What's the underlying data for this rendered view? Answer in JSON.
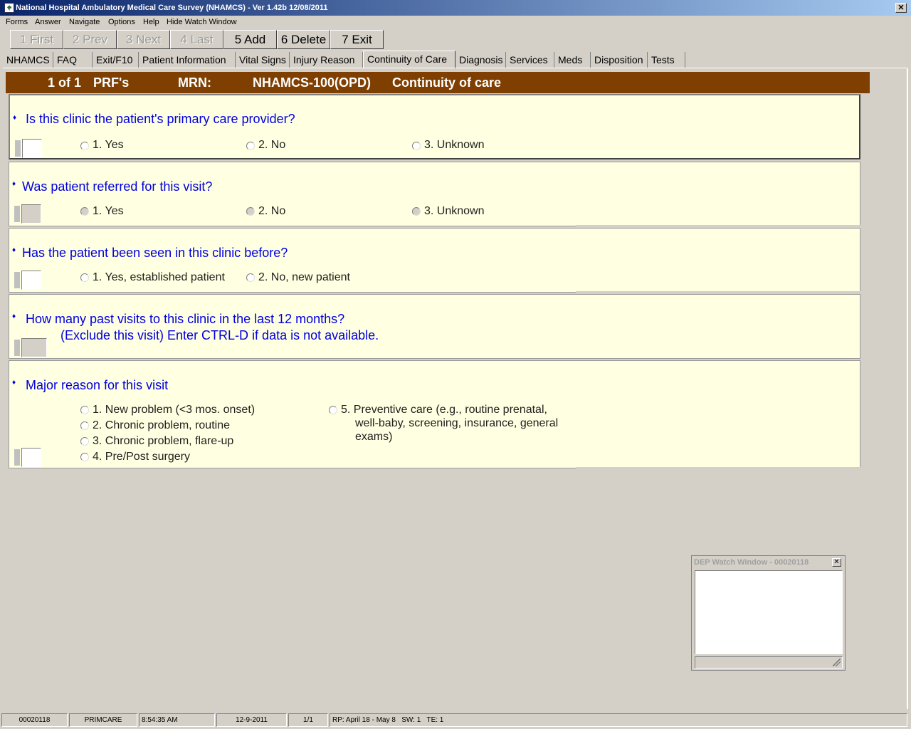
{
  "window": {
    "title": "National Hospital Ambulatory Medical Care Survey (NHAMCS) - Ver 1.42b 12/08/2011",
    "close": "✕"
  },
  "menu": [
    "Forms",
    "Answer",
    "Navigate",
    "Options",
    "Help",
    "Hide Watch Window"
  ],
  "toolbar": {
    "first": "1 First",
    "prev": "2 Prev",
    "next": "3 Next",
    "last": "4 Last",
    "add": "5 Add",
    "delete": "6 Delete",
    "exit": "7 Exit"
  },
  "tabs": [
    "NHAMCS",
    "FAQ",
    "Exit/F10",
    "Patient Information",
    "Vital Signs",
    "Injury Reason",
    "Continuity of Care",
    "Diagnosis",
    "Services",
    "Meds",
    "Disposition",
    "Tests"
  ],
  "active_tab": "Continuity of Care",
  "header": {
    "record": "1 of 1",
    "prfs": "PRF's",
    "mrn_label": "MRN:",
    "form": "NHAMCS-100(OPD)",
    "section": "Continuity of care"
  },
  "questions": {
    "q1": {
      "text": "Is this clinic the patient's primary care provider?",
      "options": [
        "1. Yes",
        "2. No",
        "3. Unknown"
      ]
    },
    "q2": {
      "text": "Was patient referred for this visit?",
      "options": [
        "1. Yes",
        "2. No",
        "3. Unknown"
      ]
    },
    "q3": {
      "text": "Has the patient been seen in this clinic before?",
      "options": [
        "1. Yes, established patient",
        "2. No, new patient"
      ]
    },
    "q4": {
      "text": "How many past visits to this clinic in the last 12 months?",
      "subtext": "(Exclude this visit) Enter CTRL-D if data is not available."
    },
    "q5": {
      "text": "Major reason for this visit",
      "options": [
        "1. New problem (<3 mos. onset)",
        "2. Chronic problem, routine",
        "3. Chronic problem, flare-up",
        "4. Pre/Post surgery"
      ],
      "option5_lines": [
        "5. Preventive care (e.g., routine prenatal,",
        "well-baby, screening, insurance, general",
        "exams)"
      ]
    }
  },
  "bullet": "♦",
  "watch_window": {
    "title": "DEP Watch Window - 00020118",
    "close": "✕"
  },
  "status": {
    "id": "00020118",
    "clinic": "PRIMCARE",
    "time": "8:54:35 AM",
    "date": "12-9-2011",
    "page": "1/1",
    "info": "RP: April 18 - May 8   SW: 1   TE: 1"
  }
}
